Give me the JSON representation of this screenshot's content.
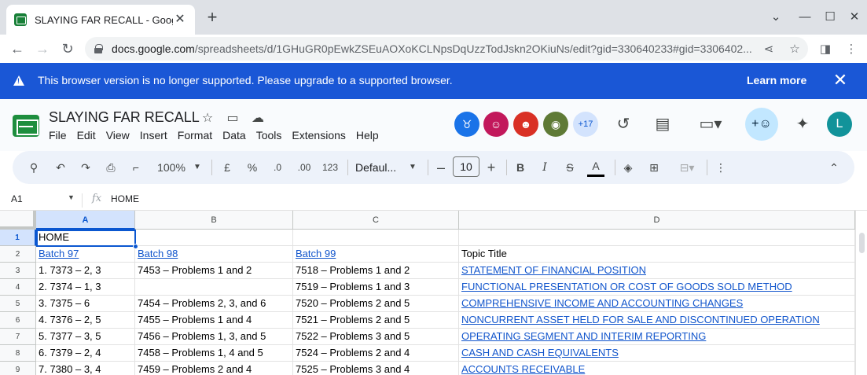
{
  "browser": {
    "tab_title": "SLAYING FAR RECALL - Google Sh",
    "url_host": "docs.google.com",
    "url_path": "/spreadsheets/d/1GHuGR0pEwkZSEuAOXoKCLNpsDqUzzTodJskn2OKiuNs/edit?gid=330640233#gid=3306402..."
  },
  "banner": {
    "message": "This browser version is no longer supported. Please upgrade to a supported browser.",
    "link": "Learn more"
  },
  "doc": {
    "title": "SLAYING FAR RECALL",
    "menus": [
      "File",
      "Edit",
      "View",
      "Insert",
      "Format",
      "Data",
      "Tools",
      "Extensions",
      "Help"
    ],
    "collaborators_more": "+17",
    "user_initial": "L",
    "avatar_colors": [
      "#1a73e8",
      "#c2185b",
      "#d93025",
      "#5f7a36"
    ]
  },
  "toolbar": {
    "zoom": "100%",
    "currency": "£",
    "percent": "%",
    "dec_decrease": ".0",
    "dec_increase": ".00",
    "number_format": "123",
    "font": "Defaul...",
    "font_size": "10",
    "bold": "B",
    "italic": "I",
    "strike": "S",
    "text_color": "A"
  },
  "formula_bar": {
    "cell_ref": "A1",
    "value": "HOME"
  },
  "sheet": {
    "columns": [
      "A",
      "B",
      "C",
      "D"
    ],
    "rows": [
      [
        "1",
        "HOME",
        "",
        "",
        ""
      ],
      [
        "2",
        "Batch 97",
        "Batch 98",
        "Batch 99",
        "Topic Title"
      ],
      [
        "3",
        "1. 7373 – 2, 3",
        "7453 – Problems 1 and 2",
        "7518 – Problems 1 and 2",
        "STATEMENT OF FINANCIAL POSITION"
      ],
      [
        "4",
        "2. 7374 – 1, 3",
        "",
        "7519 – Problems 1 and 3",
        "FUNCTIONAL PRESENTATION OR COST OF GOODS SOLD METHOD"
      ],
      [
        "5",
        "3. 7375 – 6",
        "7454 – Problems 2, 3, and 6",
        "7520 – Problems 2 and 5",
        "COMPREHENSIVE INCOME AND ACCOUNTING CHANGES"
      ],
      [
        "6",
        "4. 7376 – 2, 5",
        "7455 – Problems 1 and 4",
        "7521 – Problems 2 and 5",
        "NONCURRENT ASSET HELD FOR SALE AND DISCONTINUED OPERATION"
      ],
      [
        "7",
        "5. 7377 – 3, 5",
        "7456 – Problems 1, 3, and 5",
        "7522 – Problems 3 and 5",
        "OPERATING SEGMENT AND INTERIM REPORTING"
      ],
      [
        "8",
        "6. 7379 – 2, 4",
        "7458 – Problems 1, 4 and 5",
        "7524 – Problems 2 and 4",
        "CASH AND CASH EQUIVALENTS"
      ],
      [
        "9",
        "7. 7380 – 3, 4",
        "7459 – Problems 2 and 4",
        "7525 – Problems 3 and 4",
        "ACCOUNTS RECEIVABLE"
      ]
    ]
  }
}
